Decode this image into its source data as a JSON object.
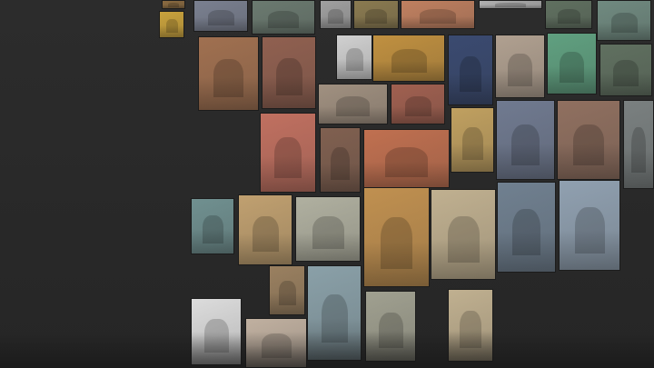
{
  "background_color": "#2b2b2b",
  "tiles": [
    {
      "color": "#8a6a40"
    },
    {
      "color": "#c9a23c"
    },
    {
      "color": "#7a8090"
    },
    {
      "color": "#6b7a70"
    },
    {
      "color": "#a0a0a0"
    },
    {
      "color": "#8a7a50"
    },
    {
      "color": "#c08060"
    },
    {
      "color": "#b0b0b0"
    },
    {
      "color": "#607060"
    },
    {
      "color": "#708a80"
    },
    {
      "color": "#a07050"
    },
    {
      "color": "#906050"
    },
    {
      "color": "#d0d0d0"
    },
    {
      "color": "#c09040"
    },
    {
      "color": "#3a4a70"
    },
    {
      "color": "#b0a090"
    },
    {
      "color": "#60a080"
    },
    {
      "color": "#607060"
    },
    {
      "color": "#a09080"
    },
    {
      "color": "#a06050"
    },
    {
      "color": "#c07060"
    },
    {
      "color": "#806050"
    },
    {
      "color": "#c07050"
    },
    {
      "color": "#c0a060"
    },
    {
      "color": "#707a90"
    },
    {
      "color": "#907060"
    },
    {
      "color": "#7a8080"
    },
    {
      "color": "#709090"
    },
    {
      "color": "#c0a070"
    },
    {
      "color": "#b0b0a0"
    },
    {
      "color": "#c09050"
    },
    {
      "color": "#c0b090"
    },
    {
      "color": "#708090"
    },
    {
      "color": "#90a0b0"
    },
    {
      "color": "#9a8060"
    },
    {
      "color": "#8aa0a8"
    },
    {
      "color": "#a0a090"
    },
    {
      "color": "#c0b090"
    },
    {
      "color": "#dcdcdc"
    },
    {
      "color": "#c0b0a0"
    }
  ]
}
